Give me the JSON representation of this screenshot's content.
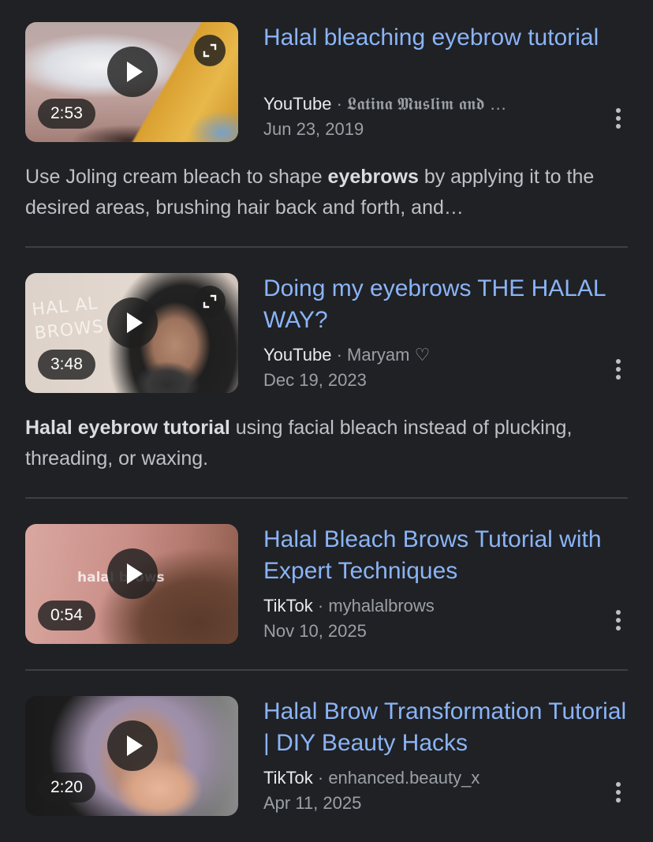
{
  "results": [
    {
      "title": "Halal bleaching eyebrow tutorial",
      "duration": "2:53",
      "source": "YouTube",
      "separator": " · ",
      "channel": "𝕷𝖆𝖙𝖎𝖓𝖆 𝕸𝖚𝖘𝖑𝖎𝖒 𝖆𝖓𝖉 …",
      "date": "Jun 23, 2019",
      "snippet_parts": [
        {
          "text": "Use Joling cream bleach to shape ",
          "bold": false
        },
        {
          "text": "eyebrows",
          "bold": true
        },
        {
          "text": " by applying it to the desired areas, brushing hair back and forth, and…",
          "bold": false
        }
      ],
      "thumb_icon": "eyebrow-bleach-thumbnail"
    },
    {
      "title": "Doing my eyebrows THE HALAL WAY?",
      "duration": "3:48",
      "source": "YouTube",
      "separator": " · ",
      "channel": "Maryam ♡",
      "date": "Dec 19, 2023",
      "snippet_parts": [
        {
          "text": "Halal eyebrow tutorial",
          "bold": true
        },
        {
          "text": " using facial bleach instead of plucking, threading, or waxing.",
          "bold": false
        }
      ],
      "thumb_text": "HAL AL BROWS"
    },
    {
      "title": "Halal Bleach Brows Tutorial with Expert Techniques",
      "duration": "0:54",
      "source": "TikTok",
      "separator": " · ",
      "channel": "myhalalbrows",
      "date": "Nov 10, 2025",
      "thumb_text": "halal brows"
    },
    {
      "title": "Halal Brow Transformation Tutorial | DIY Beauty Hacks",
      "duration": "2:20",
      "source": "TikTok",
      "separator": " · ",
      "channel": "enhanced.beauty_x",
      "date": "Apr 11, 2025"
    }
  ],
  "icons": {
    "play": "play-icon",
    "expand": "expand-icon",
    "more": "more-vert-icon"
  },
  "colors": {
    "background": "#202124",
    "title_link": "#8ab4f8",
    "text": "#bdc1c6",
    "muted": "#9aa0a6",
    "divider": "#3c4043"
  }
}
